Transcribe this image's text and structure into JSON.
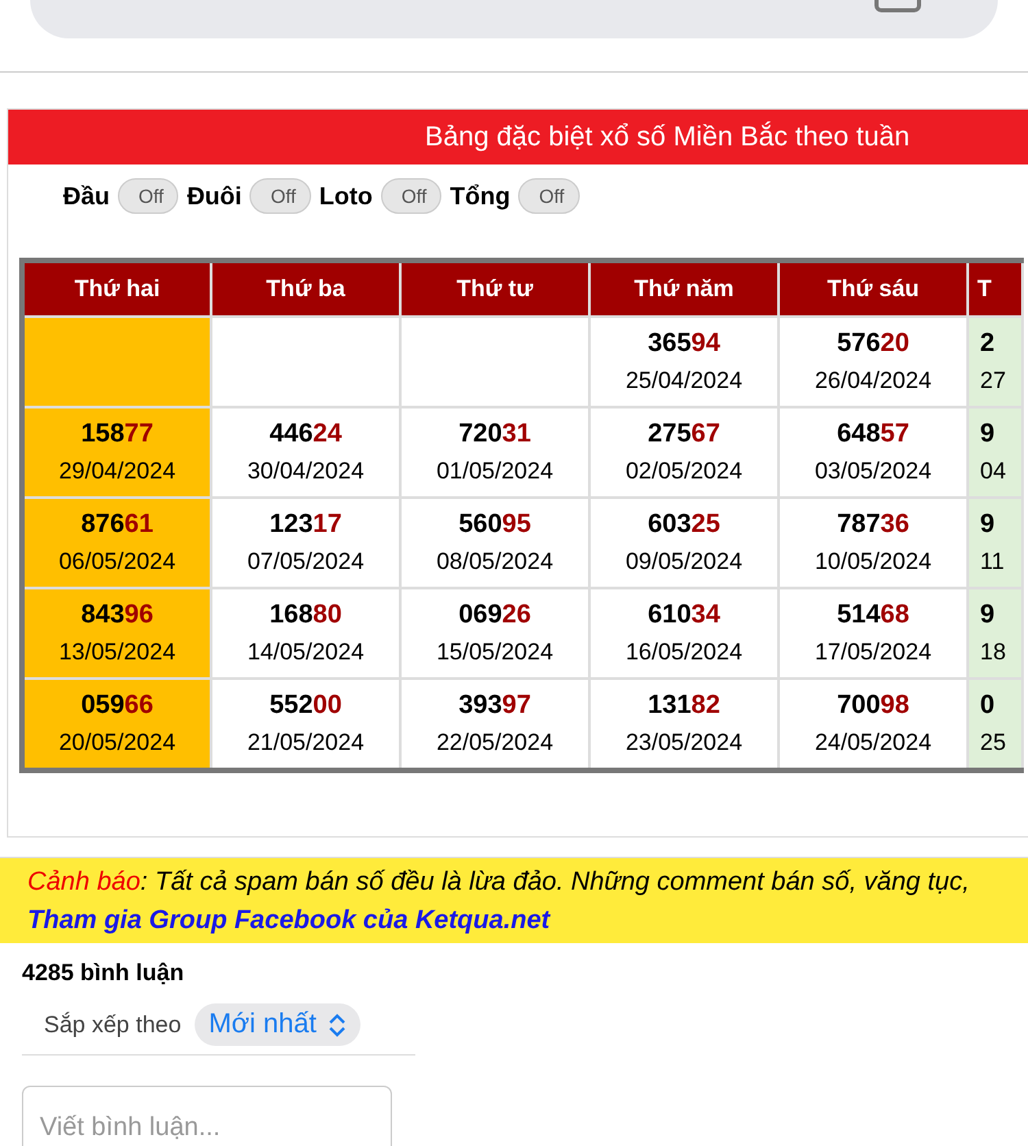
{
  "title": "Bảng đặc biệt xổ số Miền Bắc theo tuần",
  "toggles": [
    {
      "label": "Đầu",
      "state_text": "Off",
      "on": false
    },
    {
      "label": "Đuôi",
      "state_text": "Off",
      "on": false
    },
    {
      "label": "Loto",
      "state_text": "Off",
      "on": false
    },
    {
      "label": "Tổng",
      "state_text": "Off",
      "on": false
    }
  ],
  "table": {
    "columns": [
      {
        "label": "Thứ hai",
        "color": "#ffbf00"
      },
      {
        "label": "Thứ ba"
      },
      {
        "label": "Thứ tư"
      },
      {
        "label": "Thứ năm"
      },
      {
        "label": "Thứ sáu"
      },
      {
        "label": "T",
        "color": "#dff0d8"
      }
    ],
    "rows": [
      [
        {},
        {},
        {},
        {
          "head": "365",
          "tail": "94",
          "date": "25/04/2024"
        },
        {
          "head": "576",
          "tail": "20",
          "date": "26/04/2024"
        },
        {
          "head": "2",
          "date": "27"
        }
      ],
      [
        {
          "head": "158",
          "tail": "77",
          "date": "29/04/2024"
        },
        {
          "head": "446",
          "tail": "24",
          "date": "30/04/2024"
        },
        {
          "head": "720",
          "tail": "31",
          "date": "01/05/2024"
        },
        {
          "head": "275",
          "tail": "67",
          "date": "02/05/2024"
        },
        {
          "head": "648",
          "tail": "57",
          "date": "03/05/2024"
        },
        {
          "head": "9",
          "date": "04"
        }
      ],
      [
        {
          "head": "876",
          "tail": "61",
          "date": "06/05/2024"
        },
        {
          "head": "123",
          "tail": "17",
          "date": "07/05/2024"
        },
        {
          "head": "560",
          "tail": "95",
          "date": "08/05/2024"
        },
        {
          "head": "603",
          "tail": "25",
          "date": "09/05/2024"
        },
        {
          "head": "787",
          "tail": "36",
          "date": "10/05/2024"
        },
        {
          "head": "9",
          "date": "11"
        }
      ],
      [
        {
          "head": "843",
          "tail": "96",
          "date": "13/05/2024"
        },
        {
          "head": "168",
          "tail": "80",
          "date": "14/05/2024"
        },
        {
          "head": "069",
          "tail": "26",
          "date": "15/05/2024"
        },
        {
          "head": "610",
          "tail": "34",
          "date": "16/05/2024"
        },
        {
          "head": "514",
          "tail": "68",
          "date": "17/05/2024"
        },
        {
          "head": "9",
          "date": "18"
        }
      ],
      [
        {
          "head": "059",
          "tail": "66",
          "date": "20/05/2024"
        },
        {
          "head": "552",
          "tail": "00",
          "date": "21/05/2024"
        },
        {
          "head": "393",
          "tail": "97",
          "date": "22/05/2024"
        },
        {
          "head": "131",
          "tail": "82",
          "date": "23/05/2024"
        },
        {
          "head": "700",
          "tail": "98",
          "date": "24/05/2024"
        },
        {
          "head": "0",
          "date": "25"
        }
      ]
    ]
  },
  "warning": {
    "text": "*Cảnh báo*: Tất cả spam bán số đều là lừa đảo. Những comment bán số, văng tục,",
    "link": "Tham gia Group Facebook của Ketqua.net"
  },
  "comments": {
    "count": "4285 bình luận",
    "sort_label": "Sắp xếp theo",
    "sort_value": "Mới nhất",
    "placeholder": "Viết bình luận..."
  }
}
